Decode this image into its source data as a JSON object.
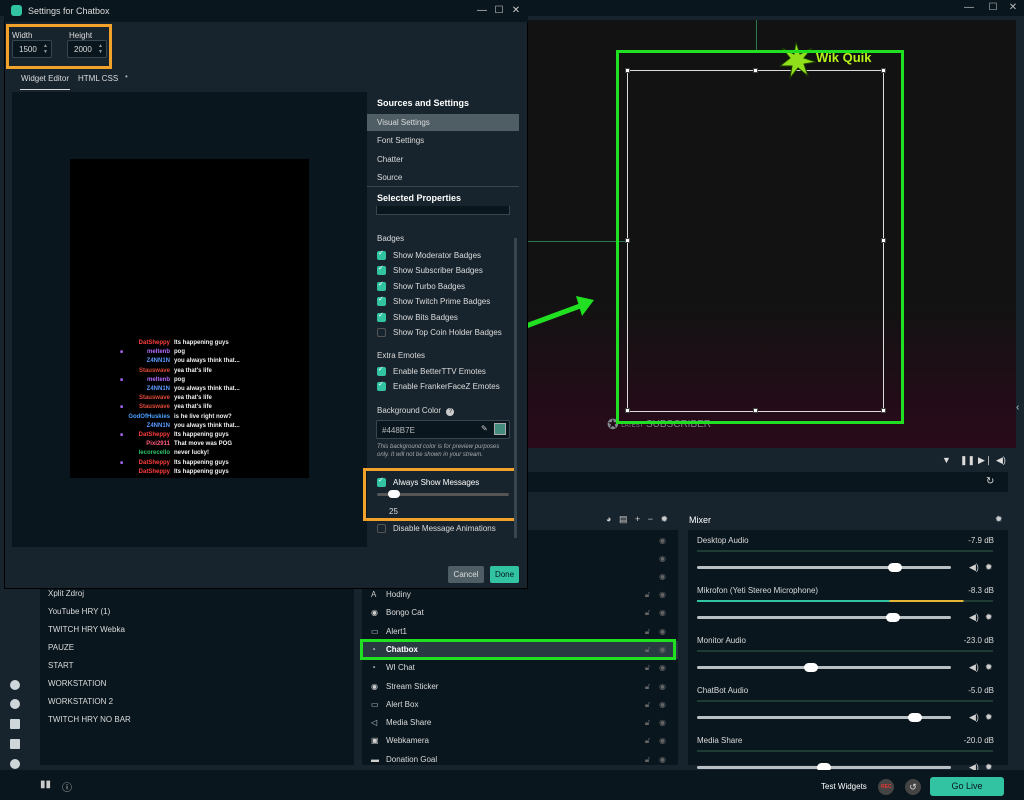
{
  "dialog": {
    "title": "Settings for Chatbox",
    "width_label": "Width",
    "width_value": "1500",
    "height_label": "Height",
    "height_value": "2000",
    "tabs": [
      "Widget Editor",
      "HTML CSS"
    ],
    "tab_dot": "•",
    "sources_settings_title": "Sources and Settings",
    "menu": [
      "Visual Settings",
      "Font Settings",
      "Chatter",
      "Source"
    ],
    "selected_properties_title": "Selected Properties",
    "badges_title": "Badges",
    "badges": [
      {
        "label": "Show Moderator Badges",
        "checked": true
      },
      {
        "label": "Show Subscriber Badges",
        "checked": true
      },
      {
        "label": "Show Turbo Badges",
        "checked": true
      },
      {
        "label": "Show Twitch Prime Badges",
        "checked": true
      },
      {
        "label": "Show Bits Badges",
        "checked": true
      },
      {
        "label": "Show Top Coin Holder Badges",
        "checked": false
      }
    ],
    "extra_emotes_title": "Extra Emotes",
    "emotes": [
      {
        "label": "Enable BetterTTV Emotes",
        "checked": true
      },
      {
        "label": "Enable FrankerFaceZ Emotes",
        "checked": true
      }
    ],
    "bg_color_title": "Background Color",
    "bg_color_value": "#448B7E",
    "bg_note": "This background color is for preview purposes only. It will not be shown in your stream.",
    "always_show_label": "Always Show Messages",
    "slider_value": "25",
    "disable_anim_label": "Disable Message Animations",
    "cancel": "Cancel",
    "done": "Done",
    "chat": [
      {
        "name": "DatSheppy",
        "color": "#ff3d3d",
        "msg": "Its happening guys"
      },
      {
        "name": "meltenb",
        "color": "#b16cff",
        "msg": "pog"
      },
      {
        "name": "Z4NN1N",
        "color": "#5a9aff",
        "msg": "you always think that..."
      },
      {
        "name": "Stauswave",
        "color": "#e04a3a",
        "msg": "yea that's life"
      },
      {
        "name": "meltenb",
        "color": "#b16cff",
        "msg": "pog"
      },
      {
        "name": "Z4NN1N",
        "color": "#5a9aff",
        "msg": "you always think that..."
      },
      {
        "name": "Stauswave",
        "color": "#e04a3a",
        "msg": "yea that's life"
      },
      {
        "name": "Stauswave",
        "color": "#e04a3a",
        "msg": "yea that's life"
      },
      {
        "name": "GodOfHuskies",
        "color": "#4aa0ff",
        "msg": "is he live right now?"
      },
      {
        "name": "Z4NN1N",
        "color": "#5a9aff",
        "msg": "you always think that..."
      },
      {
        "name": "DatSheppy",
        "color": "#ff3d3d",
        "msg": "Its happening guys"
      },
      {
        "name": "Pixi2911",
        "color": "#ff5a7a",
        "msg": "That move was POG"
      },
      {
        "name": "lecorecello",
        "color": "#2fc46a",
        "msg": "never lucky!"
      },
      {
        "name": "DatSheppy",
        "color": "#ff3d3d",
        "msg": "Its happening guys"
      },
      {
        "name": "DatSheppy",
        "color": "#ff3d3d",
        "msg": "Its happening guys"
      }
    ]
  },
  "preview": {
    "logo_text": "Wik Quik",
    "latest_text": "LATEST",
    "subscriber_text": "SUBSCRIBER"
  },
  "scenes": [
    "Xplit Zdroj",
    "YouTube HRY (1)",
    "TWITCH HRY Webka",
    "PAUZE",
    "START",
    "WORKSTATION",
    "WORKSTATION 2",
    "TWITCH HRY NO BAR"
  ],
  "sources": [
    {
      "label": "Hodiny",
      "icon": "A"
    },
    {
      "label": "Bongo Cat",
      "icon": "◉"
    },
    {
      "label": "Alert1",
      "icon": "▭"
    },
    {
      "label": "Chatbox",
      "icon": "◔"
    },
    {
      "label": "WI Chat",
      "icon": "◔"
    },
    {
      "label": "Stream Sticker",
      "icon": "◉"
    },
    {
      "label": "Alert Box",
      "icon": "▭"
    },
    {
      "label": "Media Share",
      "icon": "◁"
    },
    {
      "label": "Webkamera",
      "icon": "▣"
    },
    {
      "label": "Donation Goal",
      "icon": "▬"
    }
  ],
  "mixer": {
    "title": "Mixer",
    "channels": [
      {
        "name": "Desktop Audio",
        "db": "-7.9 dB",
        "level": 0.78
      },
      {
        "name": "Mikrofon (Yeti Stereo Microphone)",
        "db": "-8.3 dB",
        "level": 0.77
      },
      {
        "name": "Monitor Audio",
        "db": "-23.0 dB",
        "level": 0.45
      },
      {
        "name": "ChatBot Audio",
        "db": "-5.0 dB",
        "level": 0.86
      },
      {
        "name": "Media Share",
        "db": "-20.0 dB",
        "level": 0.5
      }
    ]
  },
  "footer": {
    "test_widgets": "Test Widgets",
    "rec": "REC",
    "go_live": "Go Live"
  },
  "colors": {
    "accent": "#31c3a2",
    "highlight_green": "#21e021",
    "highlight_orange": "#f2a12a"
  }
}
